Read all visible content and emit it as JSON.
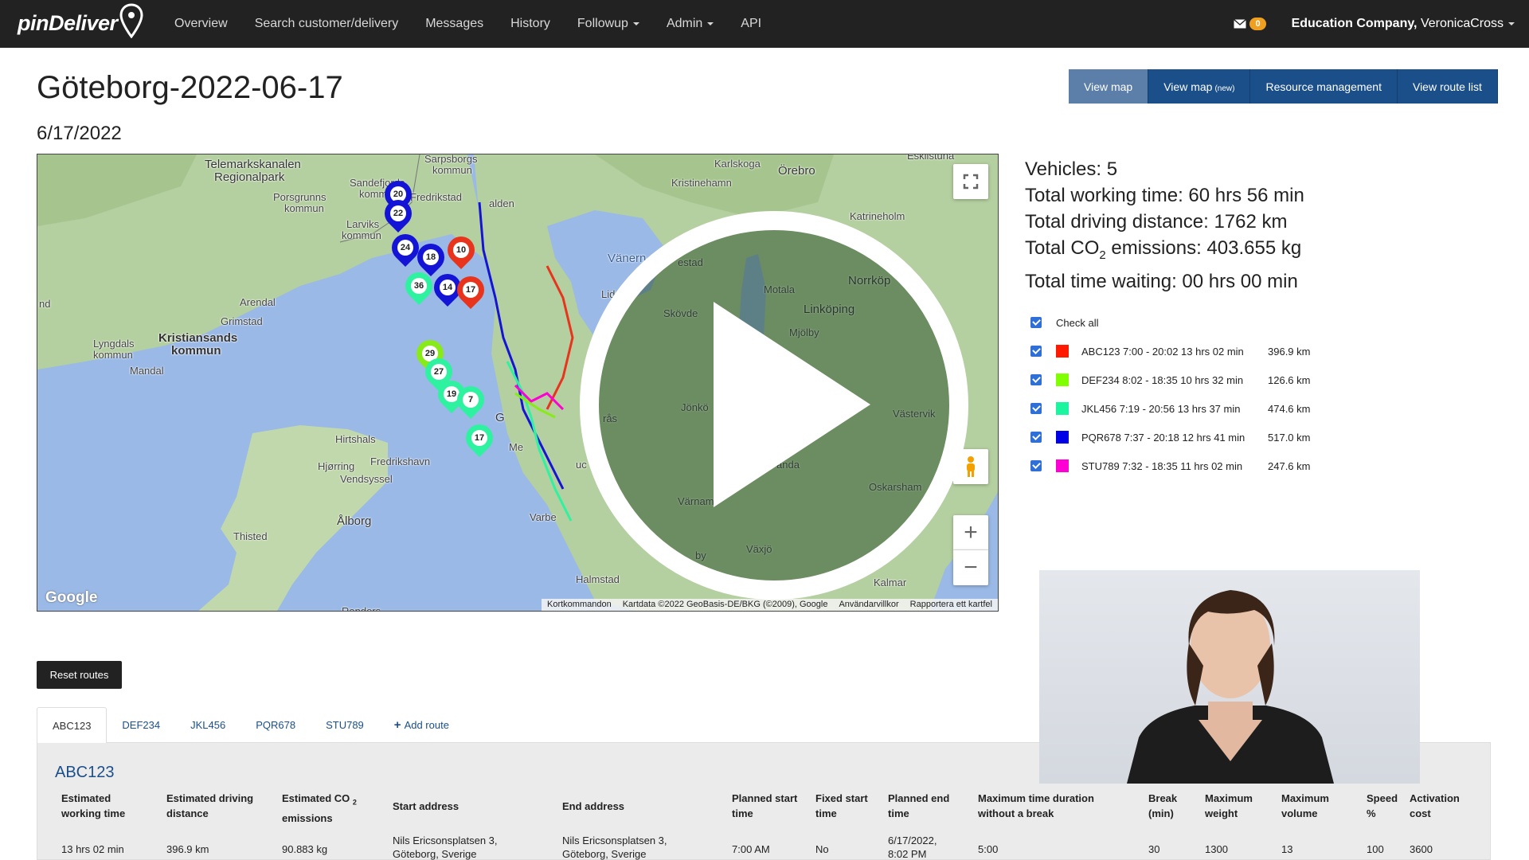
{
  "nav": {
    "brand": "pinDeliver",
    "items": [
      "Overview",
      "Search customer/delivery",
      "Messages",
      "History",
      "Followup",
      "Admin",
      "API"
    ],
    "mail_count": "0",
    "company": "Education Company,",
    "user": "VeronicaCross"
  },
  "page": {
    "title": "Göteborg-2022-06-17",
    "date": "6/17/2022"
  },
  "buttons": {
    "view_map": "View map",
    "view_map_new": "View map",
    "view_map_new_tag": "(new)",
    "resource_management": "Resource management",
    "view_route_list": "View route list"
  },
  "map": {
    "labels": {
      "telemark": "Telemarkskanalen",
      "regionalpark": "Regionalpark",
      "sarpsborg": "Sarpsborgs",
      "kommun1": "kommun",
      "sandefjord": "Sandefjords",
      "kommun2": "kommun",
      "fredrikstad": "Fredrikstad",
      "halden": "alden",
      "porsgrunn": "Porsgrunns",
      "kommun3": "kommun",
      "larvik": "Larviks",
      "kommun4": "kommun",
      "arendal": "Arendal",
      "grimstad": "Grimstad",
      "kristiansand": "Kristiansands",
      "kommun5": "kommun",
      "lyngdal": "Lyngdals",
      "kommun6": "kommun",
      "mandal": "Mandal",
      "karlskoga": "Karlskoga",
      "orebro": "Örebro",
      "kristinehamn": "Kristinehamn",
      "eskilstuna": "Eskilstuna",
      "katrineholm": "Katrineholm",
      "vanern": "Vänern",
      "norrkoping": "Norrköp",
      "motala": "Motala",
      "linkoping": "Linköping",
      "skovde": "Skövde",
      "mjolby": "Mjölby",
      "jonkoping": "Jönkö",
      "vastervik": "Västervik",
      "hirtshals": "Hirtshals",
      "frederikshavn": "Fredrikshavn",
      "hjorring": "Hjørring",
      "vendsyssel": "Vendsyssel",
      "aalborg": "Ålborg",
      "thisted": "Thisted",
      "halmstad": "Halmstad",
      "kalmar": "Kalmar",
      "oskarsham": "Oskarsham",
      "vaxjo": "Växjö",
      "varnamo": "Värnam",
      "varberg": "Varbe",
      "randers": "Randers",
      "nd": "nd",
      "lid": "Lid",
      "estad": "estad",
      "landa": "anda",
      "by": "by",
      "bras": "rås",
      "me": "Me",
      "g": "G",
      "uc": "uc"
    },
    "markers": [
      {
        "num": "20",
        "color": "#1414d6"
      },
      {
        "num": "22",
        "color": "#1414d6"
      },
      {
        "num": "24",
        "color": "#1414d6"
      },
      {
        "num": "10",
        "color": "#e8341c"
      },
      {
        "num": "18",
        "color": "#1414d6"
      },
      {
        "num": "36",
        "color": "#2ef2a0"
      },
      {
        "num": "14",
        "color": "#1414d6"
      },
      {
        "num": "17",
        "color": "#e8341c"
      },
      {
        "num": "29",
        "color": "#88ea18"
      },
      {
        "num": "27",
        "color": "#2ef2a0"
      },
      {
        "num": "19",
        "color": "#2ef2a0"
      },
      {
        "num": "7",
        "color": "#2ef2a0"
      },
      {
        "num": "17",
        "color": "#2ef2a0"
      }
    ],
    "google": "Google",
    "attribution": [
      "Kortkommandon",
      "Kartdata ©2022 GeoBasis-DE/BKG (©2009), Google",
      "Användarvillkor",
      "Rapportera ett kartfel"
    ]
  },
  "stats": {
    "vehicles": "Vehicles: 5",
    "working_time": "Total working time: 60 hrs 56 min",
    "driving_distance": "Total driving distance: 1762 km",
    "co2_prefix": "Total CO",
    "co2_sub": "2",
    "co2_suffix": " emissions: 403.655 kg",
    "waiting": "Total time waiting: 00 hrs 00 min"
  },
  "routes": {
    "check_all": "Check all",
    "items": [
      {
        "label": "ABC123 7:00 - 20:02 13 hrs 02 min",
        "distance": "396.9 km",
        "color": "#ff1a00"
      },
      {
        "label": "DEF234 8:02 - 18:35 10 hrs 32 min",
        "distance": "126.6 km",
        "color": "#80ff00"
      },
      {
        "label": "JKL456 7:19 - 20:56 13 hrs 37 min",
        "distance": "474.6 km",
        "color": "#1cf5a0"
      },
      {
        "label": "PQR678 7:37 - 20:18 12 hrs 41 min",
        "distance": "517.0 km",
        "color": "#0000e6"
      },
      {
        "label": "STU789 7:32 - 18:35 11 hrs 02 min",
        "distance": "247.6 km",
        "color": "#ff00d4"
      }
    ]
  },
  "reset": "Reset routes",
  "tabs": [
    "ABC123",
    "DEF234",
    "JKL456",
    "PQR678",
    "STU789"
  ],
  "add_route": "Add route",
  "panel": {
    "title": "ABC123",
    "headers": {
      "h1a": "Estimated",
      "h1b": "working time",
      "h2a": "Estimated driving",
      "h2b": "distance",
      "h3a": "Estimated CO",
      "h3sub": "2",
      "h3b": "emissions",
      "h4": "Start address",
      "h5": "End address",
      "h6a": "Planned start",
      "h6b": "time",
      "h7a": "Fixed start",
      "h7b": "time",
      "h8a": "Planned end",
      "h8b": "time",
      "h9a": "Maximum time duration",
      "h9b": "without a break",
      "h10a": "Break",
      "h10b": "(min)",
      "h11a": "Maximum",
      "h11b": "weight",
      "h12a": "Maximum",
      "h12b": "volume",
      "h13a": "Speed",
      "h13b": "%",
      "h14a": "Activation",
      "h14b": "cost"
    },
    "values": {
      "working_time": "13 hrs 02 min",
      "driving_distance": "396.9 km",
      "co2": "90.883 kg",
      "start_a": "Nils Ericsonsplatsen 3,",
      "start_b": "Göteborg, Sverige",
      "end_a": "Nils Ericsonsplatsen 3,",
      "end_b": "Göteborg, Sverige",
      "planned_start": "7:00 AM",
      "fixed_start": "No",
      "planned_end_a": "6/17/2022,",
      "planned_end_b": "8:02 PM",
      "max_duration": "5:00",
      "break": "30",
      "max_weight": "1300",
      "max_volume": "13",
      "speed": "100",
      "activation_cost": "3600"
    }
  }
}
